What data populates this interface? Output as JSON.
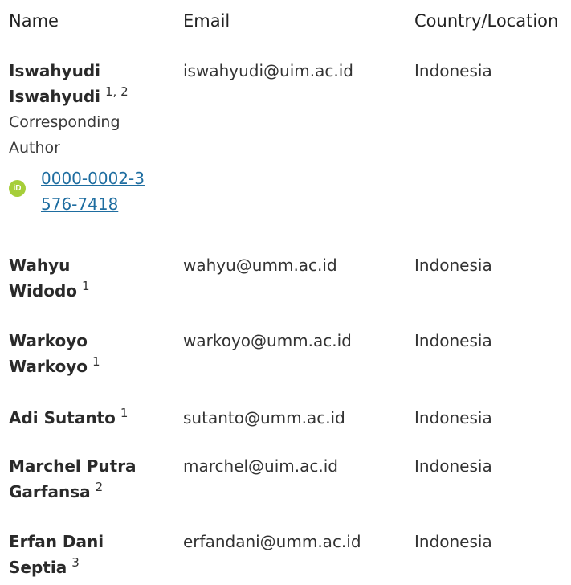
{
  "table": {
    "headers": {
      "name": "Name",
      "email": "Email",
      "country": "Country/Location"
    },
    "authors": [
      {
        "name": "Iswahyudi Iswahyudi",
        "affiliation": "1, 2",
        "role": "Corresponding Author",
        "orcid": "0000-0002-3576-7418",
        "email": "iswahyudi@uim.ac.id",
        "country": "Indonesia"
      },
      {
        "name": "Wahyu Widodo",
        "affiliation": "1",
        "email": "wahyu@umm.ac.id",
        "country": "Indonesia"
      },
      {
        "name": "Warkoyo Warkoyo",
        "affiliation": "1",
        "email": "warkoyo@umm.ac.id",
        "country": "Indonesia"
      },
      {
        "name": "Adi Sutanto",
        "affiliation": "1",
        "email": "sutanto@umm.ac.id",
        "country": "Indonesia"
      },
      {
        "name": "Marchel Putra Garfansa",
        "affiliation": "2",
        "email": "marchel@uim.ac.id",
        "country": "Indonesia"
      },
      {
        "name": "Erfan Dani Septia",
        "affiliation": "3",
        "email": "erfandani@umm.ac.id",
        "country": "Indonesia"
      }
    ]
  },
  "icons": {
    "orcid": "orcid-icon",
    "orcid_label": "iD",
    "orcid_color": "#a6ce39"
  },
  "colors": {
    "link": "#1e6da0"
  }
}
